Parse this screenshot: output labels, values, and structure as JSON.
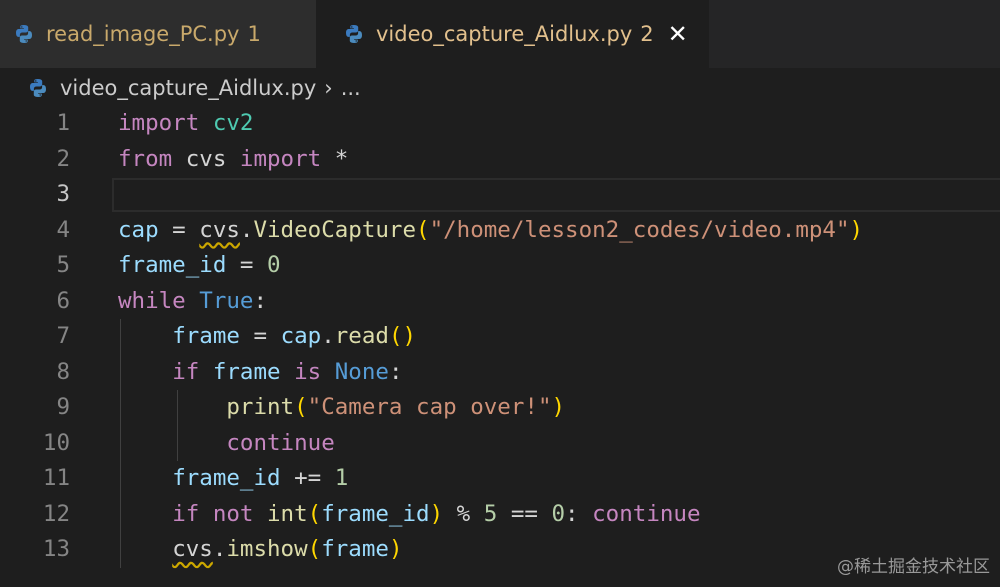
{
  "tabs": [
    {
      "filename": "read_image_PC.py",
      "badge": "1",
      "active": false
    },
    {
      "filename": "video_capture_Aidlux.py",
      "badge": "2",
      "active": true,
      "close_glyph": "✕"
    }
  ],
  "breadcrumb": {
    "filename": "video_capture_Aidlux.py",
    "separator": "›",
    "more": "..."
  },
  "icons": {
    "file_icon": "python-icon",
    "close_icon": "close-icon"
  },
  "colors": {
    "editor_bg": "#1e1e1e",
    "keyword": "#c586c0",
    "string": "#ce9178",
    "number": "#b5cea8",
    "function": "#dcdcaa",
    "variable": "#9cdcfe"
  },
  "editor": {
    "current_line": 3,
    "lines": [
      {
        "n": "1",
        "text": "import cv2"
      },
      {
        "n": "2",
        "text": "from cvs import *"
      },
      {
        "n": "3",
        "text": ""
      },
      {
        "n": "4",
        "text": "cap = cvs.VideoCapture(\"/home/lesson2_codes/video.mp4\")"
      },
      {
        "n": "5",
        "text": "frame_id = 0"
      },
      {
        "n": "6",
        "text": "while True:"
      },
      {
        "n": "7",
        "text": "    frame = cap.read()"
      },
      {
        "n": "8",
        "text": "    if frame is None:"
      },
      {
        "n": "9",
        "text": "        print(\"Camera cap over!\")"
      },
      {
        "n": "10",
        "text": "        continue"
      },
      {
        "n": "11",
        "text": "    frame_id += 1"
      },
      {
        "n": "12",
        "text": "    if not int(frame_id) % 5 == 0: continue"
      },
      {
        "n": "13",
        "text": "    cvs.imshow(frame)"
      }
    ]
  },
  "watermark": "@稀土掘金技术社区"
}
